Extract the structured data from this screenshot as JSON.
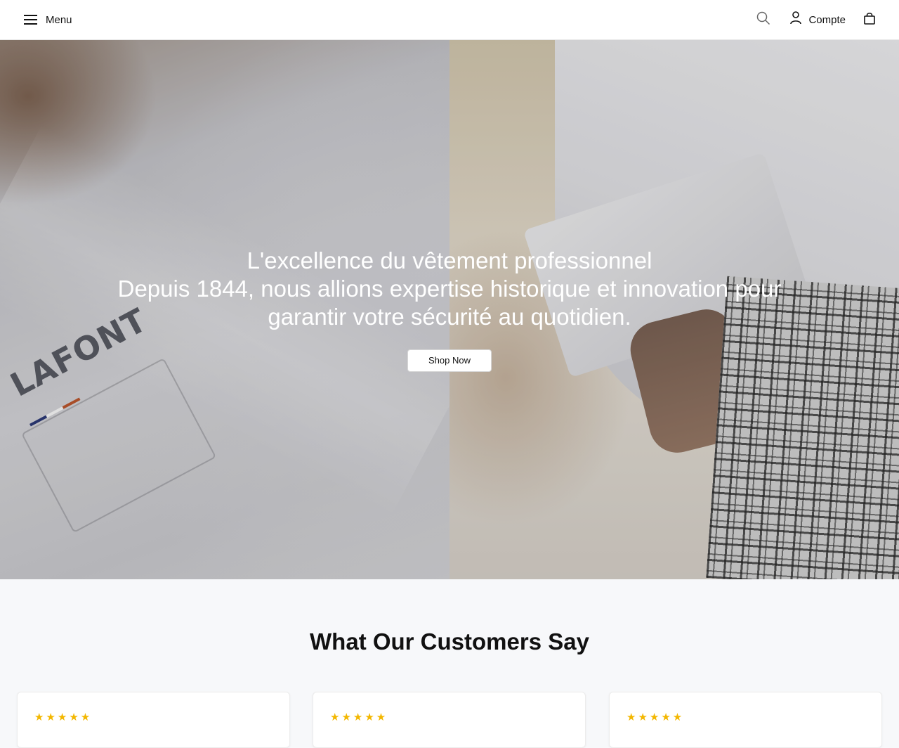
{
  "header": {
    "menu_label": "Menu",
    "account_label": "Compte",
    "icons": {
      "menu": "hamburger-icon",
      "search": "search-icon",
      "account": "user-icon",
      "cart": "shopping-bag-icon"
    }
  },
  "hero": {
    "title": "L'excellence du vêtement professionnel",
    "subtitle": "Depuis 1844, nous allions expertise historique et innovation pour garantir votre sécurité au quotidien.",
    "cta_label": "Shop Now",
    "brand_logo_text": "LAFONT"
  },
  "testimonials": {
    "title": "What Our Customers Say",
    "cards": [
      {
        "rating": 5,
        "stars": "★★★★★"
      },
      {
        "rating": 5,
        "stars": "★★★★★"
      },
      {
        "rating": 5,
        "stars": "★★★★★"
      }
    ]
  },
  "colors": {
    "star": "#f3b700",
    "header_bg": "#ffffff",
    "section_bg": "#f7f8fa"
  }
}
